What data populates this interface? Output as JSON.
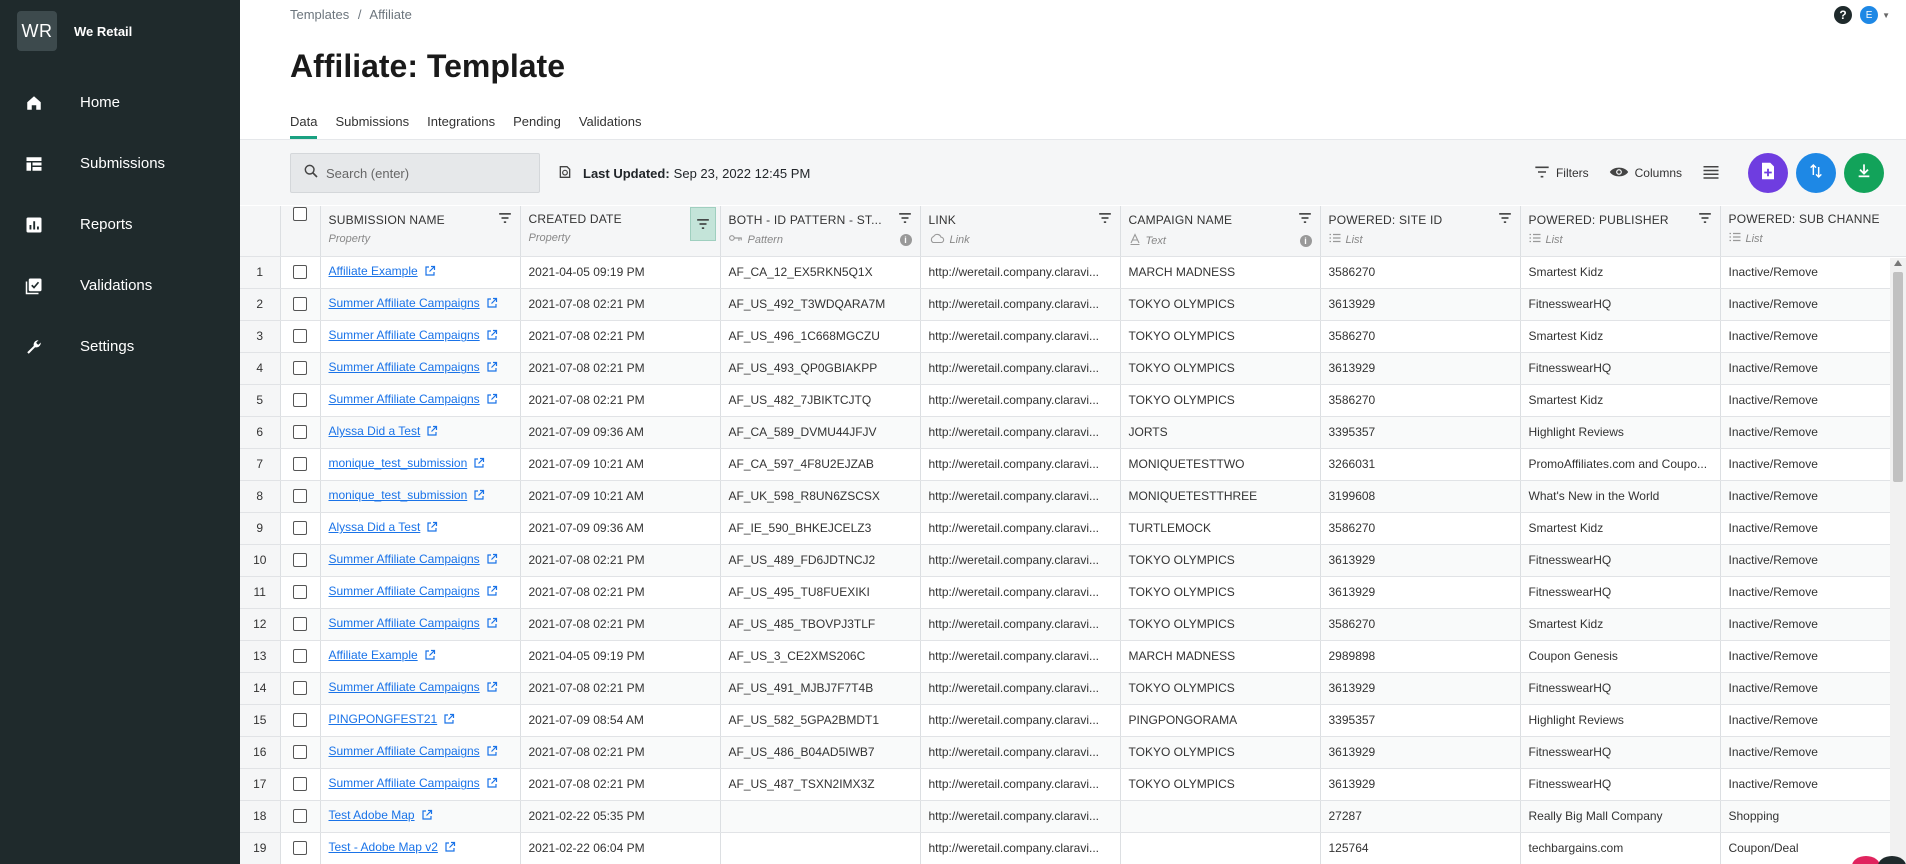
{
  "brand": {
    "logo": "WR",
    "name": "We Retail"
  },
  "sidebar": {
    "items": [
      {
        "label": "Home",
        "icon": "home-icon"
      },
      {
        "label": "Submissions",
        "icon": "table-icon"
      },
      {
        "label": "Reports",
        "icon": "chart-icon"
      },
      {
        "label": "Validations",
        "icon": "checklist-icon"
      },
      {
        "label": "Settings",
        "icon": "wrench-icon"
      }
    ]
  },
  "header": {
    "breadcrumb_parent": "Templates",
    "breadcrumb_sep": "/",
    "breadcrumb_current": "Affiliate",
    "title": "Affiliate: Template",
    "help": "?",
    "avatar": "E"
  },
  "tabs": [
    "Data",
    "Submissions",
    "Integrations",
    "Pending",
    "Validations"
  ],
  "toolbar": {
    "search_placeholder": "Search (enter)",
    "last_updated_label": "Last Updated:",
    "last_updated_value": "Sep 23, 2022 12:45 PM",
    "filters_label": "Filters",
    "columns_label": "Columns"
  },
  "colors": {
    "accent_green": "#1aa181",
    "purple": "#6f3de0",
    "blue": "#1e88e5",
    "green": "#12a35a",
    "sidebar": "#1f2a2c"
  },
  "columns": [
    {
      "title": "SUBMISSION NAME",
      "sub": "Property"
    },
    {
      "title": "CREATED DATE",
      "sub": "Property"
    },
    {
      "title": "BOTH - ID PATTERN - ST...",
      "sub": "Pattern"
    },
    {
      "title": "LINK",
      "sub": "Link"
    },
    {
      "title": "CAMPAIGN NAME",
      "sub": "Text"
    },
    {
      "title": "POWERED: SITE ID",
      "sub": "List"
    },
    {
      "title": "POWERED: PUBLISHER",
      "sub": "List"
    },
    {
      "title": "POWERED: SUB CHANNE",
      "sub": "List"
    }
  ],
  "rows": [
    {
      "n": "1",
      "name": "Affiliate Example",
      "date": "2021-04-05 09:19 PM",
      "id": "AF_CA_12_EX5RKN5Q1X",
      "link": "http://weretail.company.claravi...",
      "campaign": "MARCH MADNESS",
      "site": "3586270",
      "publisher": "Smartest Kidz",
      "sub": "Inactive/Remove"
    },
    {
      "n": "2",
      "name": "Summer Affiliate Campaigns",
      "date": "2021-07-08 02:21 PM",
      "id": "AF_US_492_T3WDQARA7M",
      "link": "http://weretail.company.claravi...",
      "campaign": "TOKYO OLYMPICS",
      "site": "3613929",
      "publisher": "FitnesswearHQ",
      "sub": "Inactive/Remove"
    },
    {
      "n": "3",
      "name": "Summer Affiliate Campaigns",
      "date": "2021-07-08 02:21 PM",
      "id": "AF_US_496_1C668MGCZU",
      "link": "http://weretail.company.claravi...",
      "campaign": "TOKYO OLYMPICS",
      "site": "3586270",
      "publisher": "Smartest Kidz",
      "sub": "Inactive/Remove"
    },
    {
      "n": "4",
      "name": "Summer Affiliate Campaigns",
      "date": "2021-07-08 02:21 PM",
      "id": "AF_US_493_QP0GBIAKPP",
      "link": "http://weretail.company.claravi...",
      "campaign": "TOKYO OLYMPICS",
      "site": "3613929",
      "publisher": "FitnesswearHQ",
      "sub": "Inactive/Remove"
    },
    {
      "n": "5",
      "name": "Summer Affiliate Campaigns",
      "date": "2021-07-08 02:21 PM",
      "id": "AF_US_482_7JBIKTCJTQ",
      "link": "http://weretail.company.claravi...",
      "campaign": "TOKYO OLYMPICS",
      "site": "3586270",
      "publisher": "Smartest Kidz",
      "sub": "Inactive/Remove"
    },
    {
      "n": "6",
      "name": "Alyssa Did a Test",
      "date": "2021-07-09 09:36 AM",
      "id": "AF_CA_589_DVMU44JFJV",
      "link": "http://weretail.company.claravi...",
      "campaign": "JORTS",
      "site": "3395357",
      "publisher": "Highlight Reviews",
      "sub": "Inactive/Remove"
    },
    {
      "n": "7",
      "name": "monique_test_submission",
      "date": "2021-07-09 10:21 AM",
      "id": "AF_CA_597_4F8U2EJZAB",
      "link": "http://weretail.company.claravi...",
      "campaign": "MONIQUETESTTWO",
      "site": "3266031",
      "publisher": "PromoAffiliates.com and Coupo...",
      "sub": "Inactive/Remove"
    },
    {
      "n": "8",
      "name": "monique_test_submission",
      "date": "2021-07-09 10:21 AM",
      "id": "AF_UK_598_R8UN6ZSCSX",
      "link": "http://weretail.company.claravi...",
      "campaign": "MONIQUETESTTHREE",
      "site": "3199608",
      "publisher": "What's New in the World",
      "sub": "Inactive/Remove"
    },
    {
      "n": "9",
      "name": "Alyssa Did a Test",
      "date": "2021-07-09 09:36 AM",
      "id": "AF_IE_590_BHKEJCELZ3",
      "link": "http://weretail.company.claravi...",
      "campaign": "TURTLEMOCK",
      "site": "3586270",
      "publisher": "Smartest Kidz",
      "sub": "Inactive/Remove"
    },
    {
      "n": "10",
      "name": "Summer Affiliate Campaigns",
      "date": "2021-07-08 02:21 PM",
      "id": "AF_US_489_FD6JDTNCJ2",
      "link": "http://weretail.company.claravi...",
      "campaign": "TOKYO OLYMPICS",
      "site": "3613929",
      "publisher": "FitnesswearHQ",
      "sub": "Inactive/Remove"
    },
    {
      "n": "11",
      "name": "Summer Affiliate Campaigns",
      "date": "2021-07-08 02:21 PM",
      "id": "AF_US_495_TU8FUEXIKI",
      "link": "http://weretail.company.claravi...",
      "campaign": "TOKYO OLYMPICS",
      "site": "3613929",
      "publisher": "FitnesswearHQ",
      "sub": "Inactive/Remove"
    },
    {
      "n": "12",
      "name": "Summer Affiliate Campaigns",
      "date": "2021-07-08 02:21 PM",
      "id": "AF_US_485_TBOVPJ3TLF",
      "link": "http://weretail.company.claravi...",
      "campaign": "TOKYO OLYMPICS",
      "site": "3586270",
      "publisher": "Smartest Kidz",
      "sub": "Inactive/Remove"
    },
    {
      "n": "13",
      "name": "Affiliate Example",
      "date": "2021-04-05 09:19 PM",
      "id": "AF_US_3_CE2XMS206C",
      "link": "http://weretail.company.claravi...",
      "campaign": "MARCH MADNESS",
      "site": "2989898",
      "publisher": "Coupon Genesis",
      "sub": "Inactive/Remove"
    },
    {
      "n": "14",
      "name": "Summer Affiliate Campaigns",
      "date": "2021-07-08 02:21 PM",
      "id": "AF_US_491_MJBJ7F7T4B",
      "link": "http://weretail.company.claravi...",
      "campaign": "TOKYO OLYMPICS",
      "site": "3613929",
      "publisher": "FitnesswearHQ",
      "sub": "Inactive/Remove"
    },
    {
      "n": "15",
      "name": "PINGPONGFEST21",
      "date": "2021-07-09 08:54 AM",
      "id": "AF_US_582_5GPA2BMDT1",
      "link": "http://weretail.company.claravi...",
      "campaign": "PINGPONGORAMA",
      "site": "3395357",
      "publisher": "Highlight Reviews",
      "sub": "Inactive/Remove"
    },
    {
      "n": "16",
      "name": "Summer Affiliate Campaigns",
      "date": "2021-07-08 02:21 PM",
      "id": "AF_US_486_B04AD5IWB7",
      "link": "http://weretail.company.claravi...",
      "campaign": "TOKYO OLYMPICS",
      "site": "3613929",
      "publisher": "FitnesswearHQ",
      "sub": "Inactive/Remove"
    },
    {
      "n": "17",
      "name": "Summer Affiliate Campaigns",
      "date": "2021-07-08 02:21 PM",
      "id": "AF_US_487_TSXN2IMX3Z",
      "link": "http://weretail.company.claravi...",
      "campaign": "TOKYO OLYMPICS",
      "site": "3613929",
      "publisher": "FitnesswearHQ",
      "sub": "Inactive/Remove"
    },
    {
      "n": "18",
      "name": "Test Adobe Map",
      "date": "2021-02-22 05:35 PM",
      "id": "",
      "link": "http://weretail.company.claravi...",
      "campaign": "",
      "site": "27287",
      "publisher": "Really Big Mall Company",
      "sub": "Shopping"
    },
    {
      "n": "19",
      "name": "Test - Adobe Map v2",
      "date": "2021-02-22 06:04 PM",
      "id": "",
      "link": "http://weretail.company.claravi...",
      "campaign": "",
      "site": "125764",
      "publisher": "techbargains.com",
      "sub": "Coupon/Deal"
    }
  ]
}
